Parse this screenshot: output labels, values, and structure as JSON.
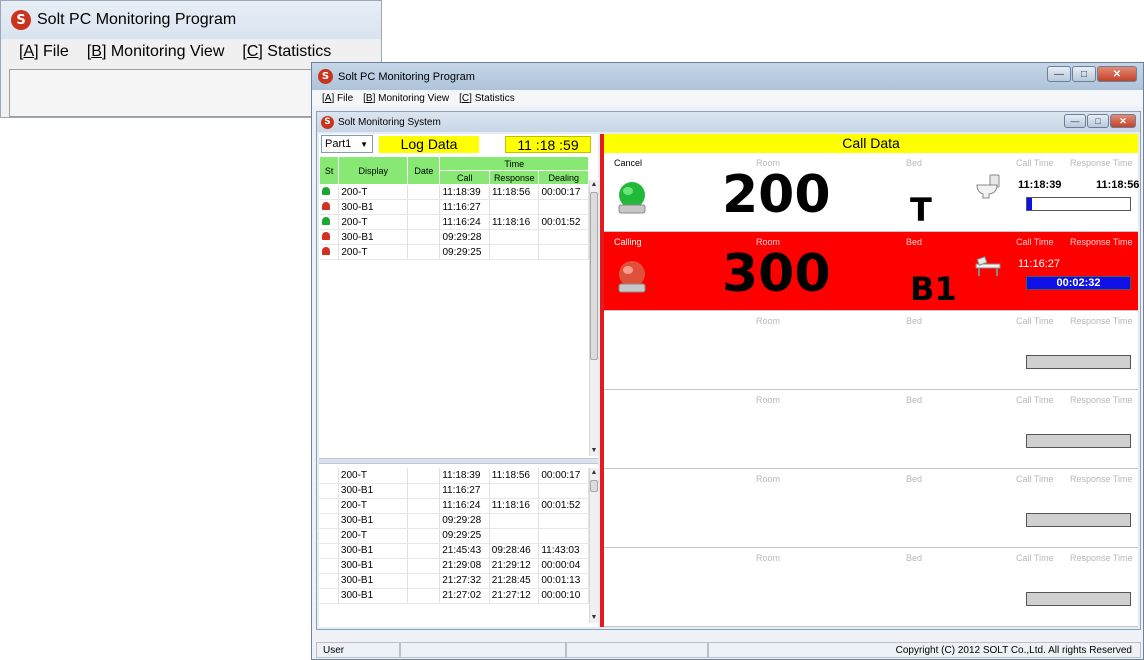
{
  "bg_window": {
    "title": "Solt PC Monitoring Program",
    "logo_letter": "S",
    "menu": [
      {
        "key": "A",
        "label": " File"
      },
      {
        "key": "B",
        "label": " Monitoring View"
      },
      {
        "key": "C",
        "label": " Statistics"
      }
    ]
  },
  "main_window": {
    "title": "Solt PC Monitoring Program",
    "logo_letter": "S",
    "menu": [
      {
        "key": "A",
        "label": " File"
      },
      {
        "key": "B",
        "label": " Monitoring View"
      },
      {
        "key": "C",
        "label": " Statistics"
      }
    ]
  },
  "child_window": {
    "title": "Solt Monitoring System",
    "logo_letter": "S"
  },
  "log_panel": {
    "part_value": "Part1",
    "title": "Log Data",
    "clock": "11 :18 :59",
    "headers": {
      "st": "St",
      "display": "Display",
      "date": "Date",
      "time": "Time",
      "call": "Call",
      "response": "Response",
      "dealing": "Dealing"
    },
    "rows": [
      {
        "lamp": "green",
        "display": "200-T",
        "date": "",
        "call": "11:18:39",
        "response": "11:18:56",
        "dealing": "00:00:17"
      },
      {
        "lamp": "red",
        "display": "300-B1",
        "date": "",
        "call": "11:16:27",
        "response": "",
        "dealing": ""
      },
      {
        "lamp": "green",
        "display": "200-T",
        "date": "",
        "call": "11:16:24",
        "response": "11:18:16",
        "dealing": "00:01:52"
      },
      {
        "lamp": "red",
        "display": "300-B1",
        "date": "",
        "call": "09:29:28",
        "response": "",
        "dealing": ""
      },
      {
        "lamp": "red",
        "display": "200-T",
        "date": "",
        "call": "09:29:25",
        "response": "",
        "dealing": ""
      }
    ],
    "history": [
      {
        "display": "200-T",
        "date": "",
        "call": "11:18:39",
        "response": "11:18:56",
        "dealing": "00:00:17"
      },
      {
        "display": "300-B1",
        "date": "",
        "call": "11:16:27",
        "response": "",
        "dealing": ""
      },
      {
        "display": "200-T",
        "date": "",
        "call": "11:16:24",
        "response": "11:18:16",
        "dealing": "00:01:52"
      },
      {
        "display": "300-B1",
        "date": "",
        "call": "09:29:28",
        "response": "",
        "dealing": ""
      },
      {
        "display": "200-T",
        "date": "",
        "call": "09:29:25",
        "response": "",
        "dealing": ""
      },
      {
        "display": "300-B1",
        "date": "",
        "call": "21:45:43",
        "response": "09:28:46",
        "dealing": "11:43:03"
      },
      {
        "display": "300-B1",
        "date": "",
        "call": "21:29:08",
        "response": "21:29:12",
        "dealing": "00:00:04"
      },
      {
        "display": "300-B1",
        "date": "",
        "call": "21:27:32",
        "response": "21:28:45",
        "dealing": "00:01:13"
      },
      {
        "display": "300-B1",
        "date": "",
        "call": "21:27:02",
        "response": "21:27:12",
        "dealing": "00:00:10"
      }
    ]
  },
  "call_panel": {
    "title": "Call Data",
    "labels": {
      "room": "Room",
      "bed": "Bed",
      "call_time": "Call Time",
      "response_time": "Response Time"
    },
    "slots": [
      {
        "state": "Cancel",
        "room": "200",
        "bed": "T",
        "call_time": "11:18:39",
        "response_time": "11:18:56",
        "bar_text": "",
        "progress": 0.05,
        "style": "white",
        "icon": "toilet-icon",
        "siren": "green"
      },
      {
        "state": "Calling",
        "room": "300",
        "bed": "B1",
        "call_time": "11:16:27",
        "response_time": "",
        "bar_text": "00:02:32",
        "progress": 1.0,
        "style": "red",
        "icon": "bed-icon",
        "siren": "red"
      },
      {
        "state": "",
        "room": "",
        "bed": "",
        "call_time": "",
        "response_time": "",
        "bar_text": "",
        "progress": 0,
        "style": "empty"
      },
      {
        "state": "",
        "room": "",
        "bed": "",
        "call_time": "",
        "response_time": "",
        "bar_text": "",
        "progress": 0,
        "style": "empty"
      },
      {
        "state": "",
        "room": "",
        "bed": "",
        "call_time": "",
        "response_time": "",
        "bar_text": "",
        "progress": 0,
        "style": "empty"
      },
      {
        "state": "",
        "room": "",
        "bed": "",
        "call_time": "",
        "response_time": "",
        "bar_text": "",
        "progress": 0,
        "style": "empty"
      }
    ]
  },
  "statusbar": {
    "user": "User",
    "copyright": "Copyright (C) 2012 SOLT Co.,Ltd. All rights Reserved"
  },
  "colors": {
    "accent_yellow": "#ffff00",
    "calling_red": "#ff0000",
    "header_green": "#88e874",
    "progress_blue": "#1010e8"
  }
}
